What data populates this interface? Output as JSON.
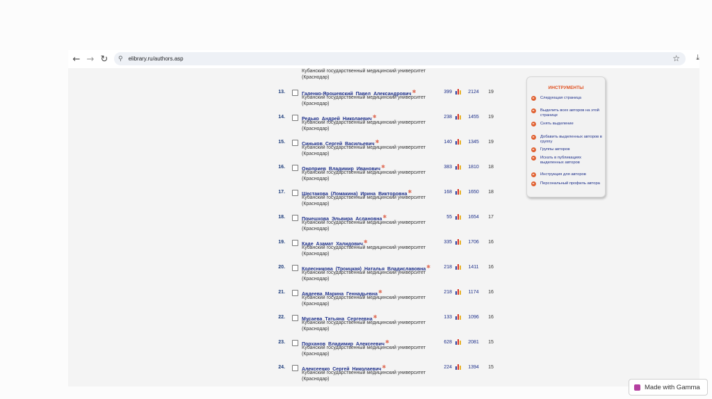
{
  "browser": {
    "url": "elibrary.ru/authors.asp",
    "back_icon": "←",
    "forward_icon": "→",
    "reload_icon": "↻",
    "site_icon": "⚲",
    "bookmark_icon": "☆",
    "download_icon": "⤓"
  },
  "partial_row": {
    "aff1": "Кубанский государственный медицинский университет",
    "aff2": "(Краснодар)"
  },
  "rows": [
    {
      "idx": "13.",
      "name": "Галенко-Ярошевский Павел Александрович",
      "aff1": "Кубанский государственный медицинский университет",
      "aff2": "(Краснодар)",
      "pubs": "399",
      "cites": "2124",
      "h": "19"
    },
    {
      "idx": "14.",
      "name": "Редько Андрей Николаевич",
      "aff1": "Кубанский государственный медицинский университет",
      "aff2": "(Краснодар)",
      "pubs": "238",
      "cites": "1455",
      "h": "19"
    },
    {
      "idx": "15.",
      "name": "Синьков Сергей Васильевич",
      "aff1": "Кубанский государственный медицинский университет",
      "aff2": "(Краснодар)",
      "pubs": "140",
      "cites": "1345",
      "h": "19"
    },
    {
      "idx": "16.",
      "name": "Оноприев Владимир Иванович",
      "aff1": "Кубанский государственный медицинский университет",
      "aff2": "(Краснодар)",
      "pubs": "383",
      "cites": "1810",
      "h": "18"
    },
    {
      "idx": "17.",
      "name": "Шестакова (Ломакина) Ирина Викторовна",
      "aff1": "Кубанский государственный медицинский университет",
      "aff2": "(Краснодар)",
      "pubs": "168",
      "cites": "1650",
      "h": "18"
    },
    {
      "idx": "18.",
      "name": "Почешхова Эльвира Аслановна",
      "aff1": "Кубанский государственный медицинский университет",
      "aff2": "(Краснодар)",
      "pubs": "55",
      "cites": "1654",
      "h": "17"
    },
    {
      "idx": "19.",
      "name": "Каде Азамат Халидович",
      "aff1": "Кубанский государственный медицинский университет",
      "aff2": "(Краснодар)",
      "pubs": "335",
      "cites": "1706",
      "h": "16"
    },
    {
      "idx": "20.",
      "name": "Колесникова (Троицкая) Наталья Владиславовна",
      "aff1": "Кубанский государственный медицинский университет",
      "aff2": "(Краснодар)",
      "pubs": "218",
      "cites": "1411",
      "h": "16"
    },
    {
      "idx": "21.",
      "name": "Авдеева Марина Геннадьевна",
      "aff1": "Кубанский государственный медицинский университет",
      "aff2": "(Краснодар)",
      "pubs": "218",
      "cites": "1174",
      "h": "16"
    },
    {
      "idx": "22.",
      "name": "Мусаева Татьяна Сергеевна",
      "aff1": "Кубанский государственный медицинский университет",
      "aff2": "(Краснодар)",
      "pubs": "133",
      "cites": "1096",
      "h": "16"
    },
    {
      "idx": "23.",
      "name": "Порханов Владимир Алексеевич",
      "aff1": "Кубанский государственный медицинский университет",
      "aff2": "(Краснодар)",
      "pubs": "628",
      "cites": "2081",
      "h": "15"
    },
    {
      "idx": "24.",
      "name": "Алексеенко Сергей Николаевич",
      "aff1": "Кубанский государственный медицинский университет",
      "aff2": "(Краснодар)",
      "pubs": "224",
      "cites": "1394",
      "h": "15"
    }
  ],
  "tools": {
    "title": "ИНСТРУМЕНТЫ",
    "items": [
      "Следующая страница",
      "Выделить всех авторов на этой странице",
      "Снять выделение",
      "Добавить выделенных авторов в группу",
      "Группы авторов",
      "Искать в публикациях выделенных авторов",
      "Инструкция для авторов",
      "Персональный профиль автора"
    ]
  },
  "gamma_badge": {
    "label": "Made with Gamma"
  },
  "colors": {
    "accent": "#e05020",
    "link": "#1d2f8a"
  }
}
